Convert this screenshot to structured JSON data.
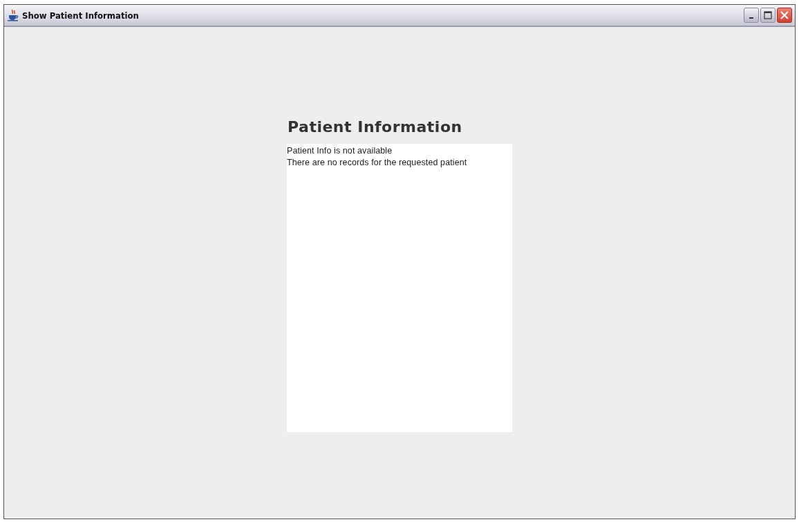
{
  "window": {
    "title": "Show Patient Information"
  },
  "heading": "Patient Information",
  "messages": [
    "Patient Info is not available",
    "There are no records for the requested patient"
  ]
}
